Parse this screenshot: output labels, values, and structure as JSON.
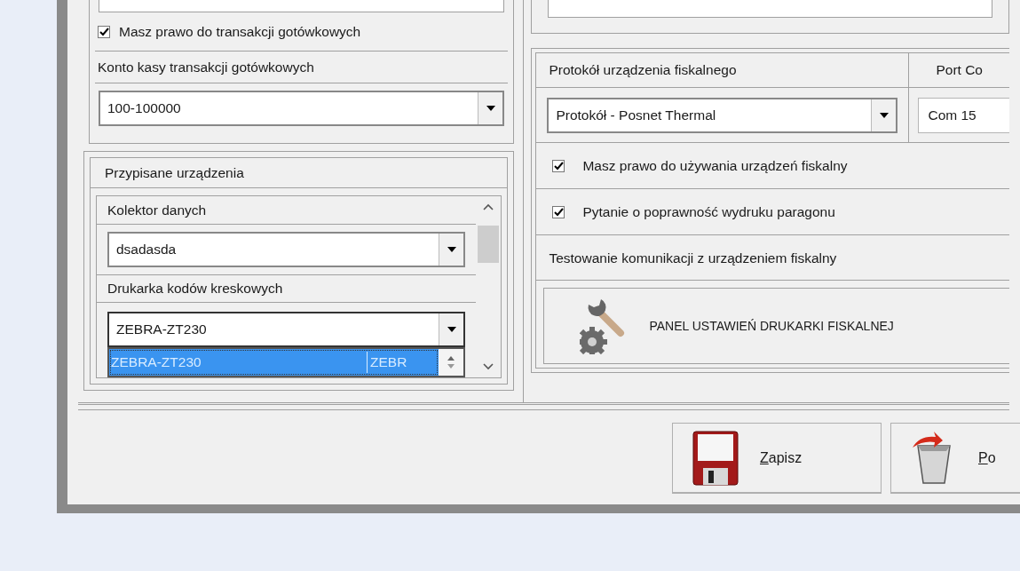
{
  "cash_permission": {
    "label": "Masz prawo do transakcji gotówkowych",
    "checked": true
  },
  "cash_account": {
    "label": "Konto kasy transakcji gotówkowych",
    "value": "100-100000"
  },
  "assigned_devices": {
    "title": "Przypisane urządzenia",
    "fields": [
      {
        "label": "Kolektor danych",
        "value": "dsadasda",
        "expanded": false
      },
      {
        "label": "Drukarka kodów kreskowych",
        "value": "ZEBRA-ZT230",
        "expanded": true,
        "dropdown_items": [
          {
            "columns": [
              "ZEBRA-ZT230",
              "ZEBR"
            ],
            "selected": true
          }
        ]
      }
    ]
  },
  "fiscal": {
    "protocol": {
      "label": "Protokół urządzenia fiskalnego",
      "value": "Protokół - Posnet Thermal"
    },
    "port": {
      "label": "Port Co",
      "value": "Com 15"
    },
    "options": [
      {
        "label": "Masz prawo do używania urządzeń fiskalny",
        "checked": true
      },
      {
        "label": "Pytanie o poprawność wydruku paragonu",
        "checked": true
      }
    ],
    "test_label": "Testowanie komunikacji z urządzeniem fiskalny",
    "settings_button": "PANEL USTAWIEŃ DRUKARKI FISKALNEJ"
  },
  "buttons": [
    {
      "label": "Zapisz",
      "kind": "save"
    },
    {
      "label": "Po",
      "kind": "cancel"
    }
  ]
}
